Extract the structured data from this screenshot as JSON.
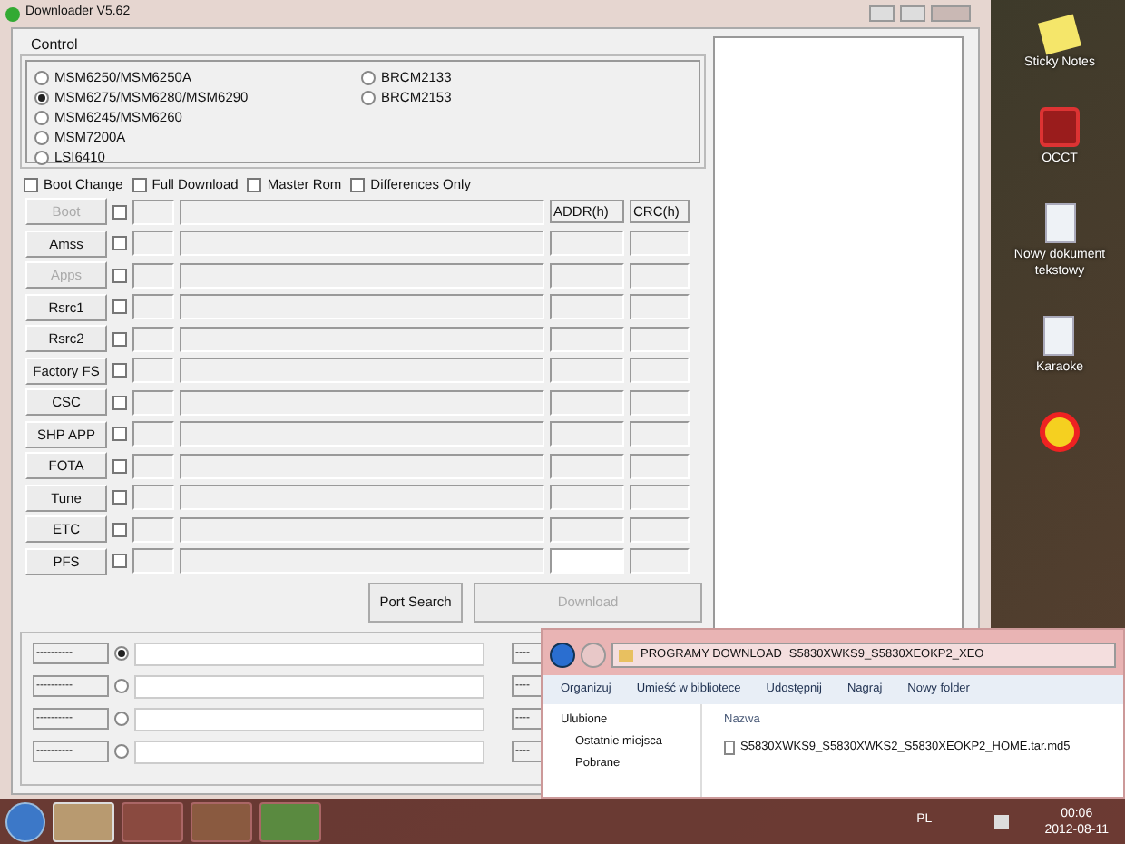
{
  "window": {
    "title": "Downloader V5.62"
  },
  "control": {
    "label": "Control",
    "chips": [
      {
        "label": "MSM6250/MSM6250A",
        "selected": false
      },
      {
        "label": "MSM6275/MSM6280/MSM6290",
        "selected": true
      },
      {
        "label": "MSM6245/MSM6260",
        "selected": false
      },
      {
        "label": "MSM7200A",
        "selected": false
      },
      {
        "label": "LSI6410",
        "selected": false
      },
      {
        "label": "BRCM2133",
        "selected": false
      },
      {
        "label": "BRCM2153",
        "selected": false
      }
    ]
  },
  "options": [
    {
      "label": "Boot Change",
      "checked": false
    },
    {
      "label": "Full Download",
      "checked": false
    },
    {
      "label": "Master Rom",
      "checked": false
    },
    {
      "label": "Differences Only",
      "checked": false
    }
  ],
  "files": {
    "addr_header": "ADDR(h)",
    "crc_header": "CRC(h)",
    "rows": [
      {
        "label": "Boot",
        "disabled": true,
        "checked": false
      },
      {
        "label": "Amss",
        "disabled": false,
        "checked": false
      },
      {
        "label": "Apps",
        "disabled": true,
        "checked": false
      },
      {
        "label": "Rsrc1",
        "disabled": false,
        "checked": false
      },
      {
        "label": "Rsrc2",
        "disabled": false,
        "checked": false
      },
      {
        "label": "Factory FS",
        "disabled": false,
        "checked": false
      },
      {
        "label": "CSC",
        "disabled": false,
        "checked": false
      },
      {
        "label": "SHP APP",
        "disabled": false,
        "checked": false
      },
      {
        "label": "FOTA",
        "disabled": false,
        "checked": false
      },
      {
        "label": "Tune",
        "disabled": false,
        "checked": false
      },
      {
        "label": "ETC",
        "disabled": false,
        "checked": false
      },
      {
        "label": "PFS",
        "disabled": false,
        "checked": false
      }
    ]
  },
  "actions": [
    {
      "label": "Port Search",
      "disabled": false
    },
    {
      "label": "Download",
      "disabled": true
    }
  ],
  "ports": [
    {
      "label": "----------",
      "selected": true,
      "right_label": "----"
    },
    {
      "label": "----------",
      "selected": false,
      "right_label": "----"
    },
    {
      "label": "----------",
      "selected": false,
      "right_label": "----"
    },
    {
      "label": "----------",
      "selected": false,
      "right_label": "----"
    }
  ],
  "desktop_icons": [
    {
      "kind": "notes",
      "label": "Sticky Notes"
    },
    {
      "kind": "app",
      "label": "OCCT"
    },
    {
      "kind": "doc",
      "label": "Nowy dokument tekstowy"
    },
    {
      "kind": "doc",
      "label": "Karaoke"
    },
    {
      "kind": "sun"
    }
  ],
  "explorer": {
    "path": [
      "PROGRAMY DOWNLOAD",
      "S5830XWKS9_S5830XEOKP2_XEO"
    ],
    "toolbar": [
      "Organizuj",
      "Umieść w bibliotece",
      "Udostępnij",
      "Nagraj",
      "Nowy folder"
    ],
    "nav": [
      "Ulubione",
      "Ostatnie miejsca",
      "Pobrane"
    ],
    "column": "Nazwa",
    "files": [
      "S5830XWKS9_S5830XWKS2_S5830XEOKP2_HOME.tar.md5"
    ]
  },
  "taskbar": {
    "language": "PL",
    "time": "00:06",
    "date": "2012-08-11"
  }
}
